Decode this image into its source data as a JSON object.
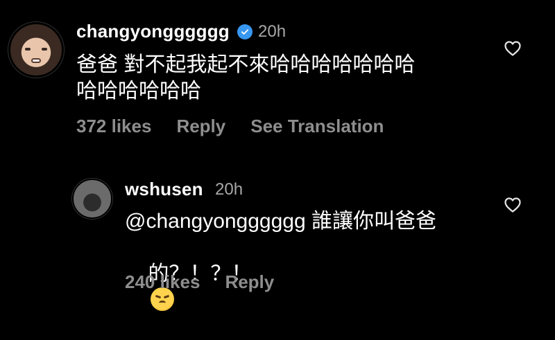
{
  "comments": [
    {
      "username": "changyongggggg",
      "verified": true,
      "time": "20h",
      "text_line1": "爸爸 對不起我起不來哈哈哈哈哈哈哈",
      "text_line2": "哈哈哈哈哈哈",
      "likes": "372 likes",
      "reply_label": "Reply",
      "translate_label": "See Translation"
    },
    {
      "username": "wshusen",
      "time": "20h",
      "text_line1": "@changyongggggg 誰讓你叫爸爸",
      "text_line2": "的？！？！",
      "likes": "240 likes",
      "reply_label": "Reply"
    }
  ],
  "colors": {
    "background": "#000000",
    "text": "#ffffff",
    "secondary": "#8e8e8e",
    "verified": "#3897f0"
  }
}
